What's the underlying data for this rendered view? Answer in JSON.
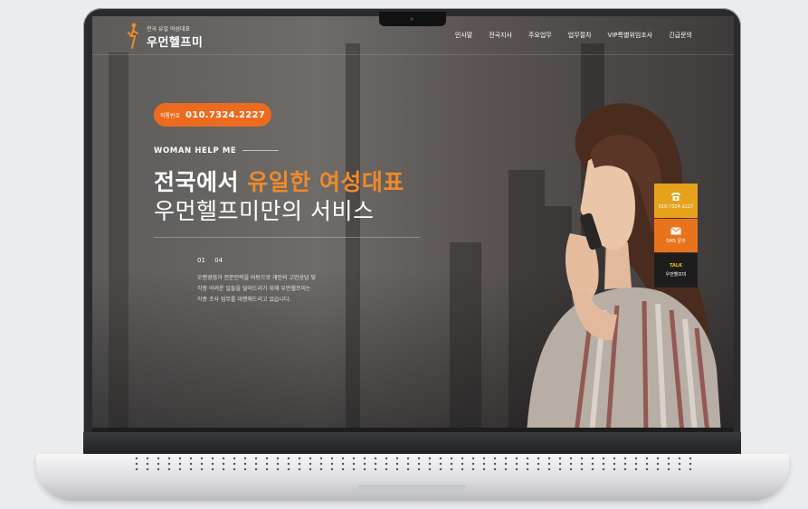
{
  "logo": {
    "tagline": "전국 유일 여성대표",
    "name": "우먼헬프미"
  },
  "nav": {
    "items": [
      "인사말",
      "전국지사",
      "주요업무",
      "업무절차",
      "VIP특별위임조사",
      "긴급문의"
    ]
  },
  "hero": {
    "pill_label": "직통번호",
    "pill_number": "010.7324.2227",
    "eyebrow": "WOMAN HELP ME",
    "title_line1_part1": "전국에서 ",
    "title_line1_highlight": "유일한 여성대표",
    "title_line2": "우먼헬프미만의 서비스",
    "pager": "01 04",
    "description": [
      "오랜경험과 전문인력을 바탕으로 개인의 고민상담 및",
      "각종 어려운 일들을 덜어드리기 위해 우먼헬프미는",
      "각종 조사 업무를 대행해드리고 있습니다."
    ]
  },
  "widgets": {
    "call_label": "010-7324-2227",
    "sms_label": "SMS 문의",
    "talk_top": "TALK",
    "talk_label": "우먼헬프미"
  },
  "colors": {
    "accent_orange": "#ec6b1e",
    "highlight_orange": "#f08a2a",
    "call_yellow": "#e6a21c",
    "talk_dark": "#1d1d1d"
  },
  "icons": {
    "phone": "phone-icon",
    "mail": "mail-icon",
    "logo": "runner-logo-icon"
  }
}
